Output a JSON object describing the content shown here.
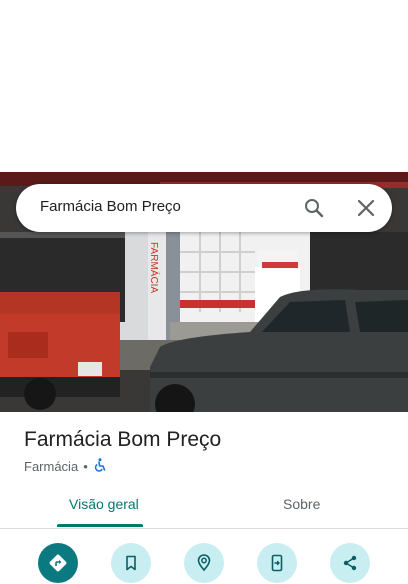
{
  "search": {
    "query": "Farmácia Bom Preço"
  },
  "place": {
    "name": "Farmácia Bom Preço",
    "category": "Farmácia",
    "separator": "•",
    "accessibility_icon": "wheelchair-icon"
  },
  "tabs": [
    {
      "label": "Visão geral",
      "selected": true
    },
    {
      "label": "Sobre",
      "selected": false
    }
  ],
  "photo": {
    "sign_text": "FARMÁCIA"
  },
  "actions": [
    {
      "icon": "directions-icon",
      "primary": true
    },
    {
      "icon": "bookmark-icon"
    },
    {
      "icon": "nearby-icon"
    },
    {
      "icon": "send-to-phone-icon"
    },
    {
      "icon": "share-icon"
    }
  ],
  "colors": {
    "accent": "#00796b",
    "action_primary": "#0b7a80",
    "action_bg": "#c9eef2"
  }
}
